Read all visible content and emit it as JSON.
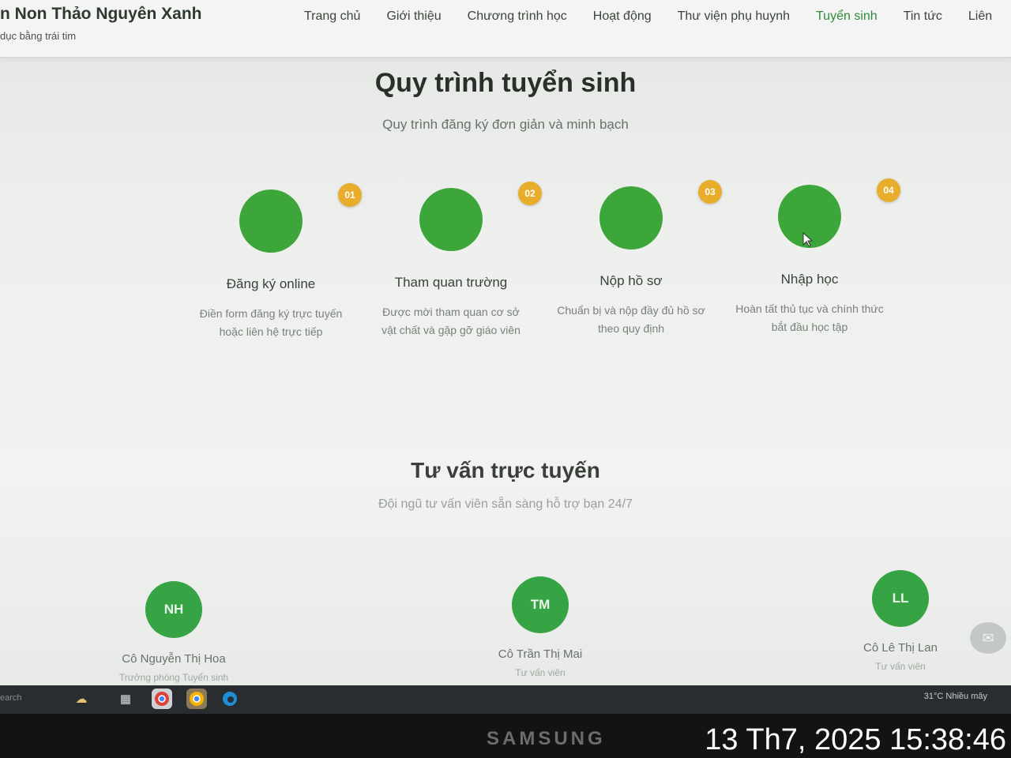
{
  "header": {
    "brand_name": "n Non Thảo Nguyên Xanh",
    "brand_tagline": "dục bằng trái tim",
    "nav": [
      {
        "label": "Trang chủ",
        "active": false
      },
      {
        "label": "Giới thiệu",
        "active": false
      },
      {
        "label": "Chương trình học",
        "active": false
      },
      {
        "label": "Hoạt động",
        "active": false
      },
      {
        "label": "Thư viện phụ huynh",
        "active": false
      },
      {
        "label": "Tuyển sinh",
        "active": true
      },
      {
        "label": "Tin tức",
        "active": false
      },
      {
        "label": "Liên",
        "active": false
      }
    ]
  },
  "process": {
    "title": "Quy trình tuyển sinh",
    "subtitle": "Quy trình đăng ký đơn giản và minh bạch",
    "steps": [
      {
        "number": "01",
        "title": "Đăng ký online",
        "desc": "Điền form đăng ký trực tuyến hoặc liên hệ trực tiếp"
      },
      {
        "number": "02",
        "title": "Tham quan trường",
        "desc": "Được mời tham quan cơ sở vật chất và gặp gỡ giáo viên"
      },
      {
        "number": "03",
        "title": "Nộp hồ sơ",
        "desc": "Chuẩn bị và nộp đầy đủ hồ sơ theo quy định"
      },
      {
        "number": "04",
        "title": "Nhập học",
        "desc": "Hoàn tất thủ tục và chính thức bắt đầu học tập"
      }
    ]
  },
  "consult": {
    "title": "Tư vấn trực tuyến",
    "subtitle": "Đội ngũ tư vấn viên sẵn sàng hỗ trợ bạn 24/7",
    "advisors": [
      {
        "initials": "NH",
        "name": "Cô Nguyễn Thị Hoa",
        "role": "Trưởng phòng Tuyển sinh"
      },
      {
        "initials": "TM",
        "name": "Cô Trần Thị Mai",
        "role": "Tư vấn viên"
      },
      {
        "initials": "LL",
        "name": "Cô Lê Thị Lan",
        "role": "Tư vấn viên"
      }
    ]
  },
  "taskbar": {
    "search_text": "earch",
    "weather": "31°C  Nhiều mây"
  },
  "monitor_brand": "SAMSUNG",
  "timestamp": "13 Th7, 2025 15:38:46",
  "colors": {
    "accent_green": "#3da63a",
    "badge_orange": "#e8ad2a",
    "active_nav": "#2e8b3a"
  },
  "icons": {
    "chat": "chat-bubble-icon",
    "taskbar": [
      "weather-icon",
      "task-view-icon",
      "chrome-icon",
      "chrome-icon",
      "edge-icon"
    ]
  }
}
